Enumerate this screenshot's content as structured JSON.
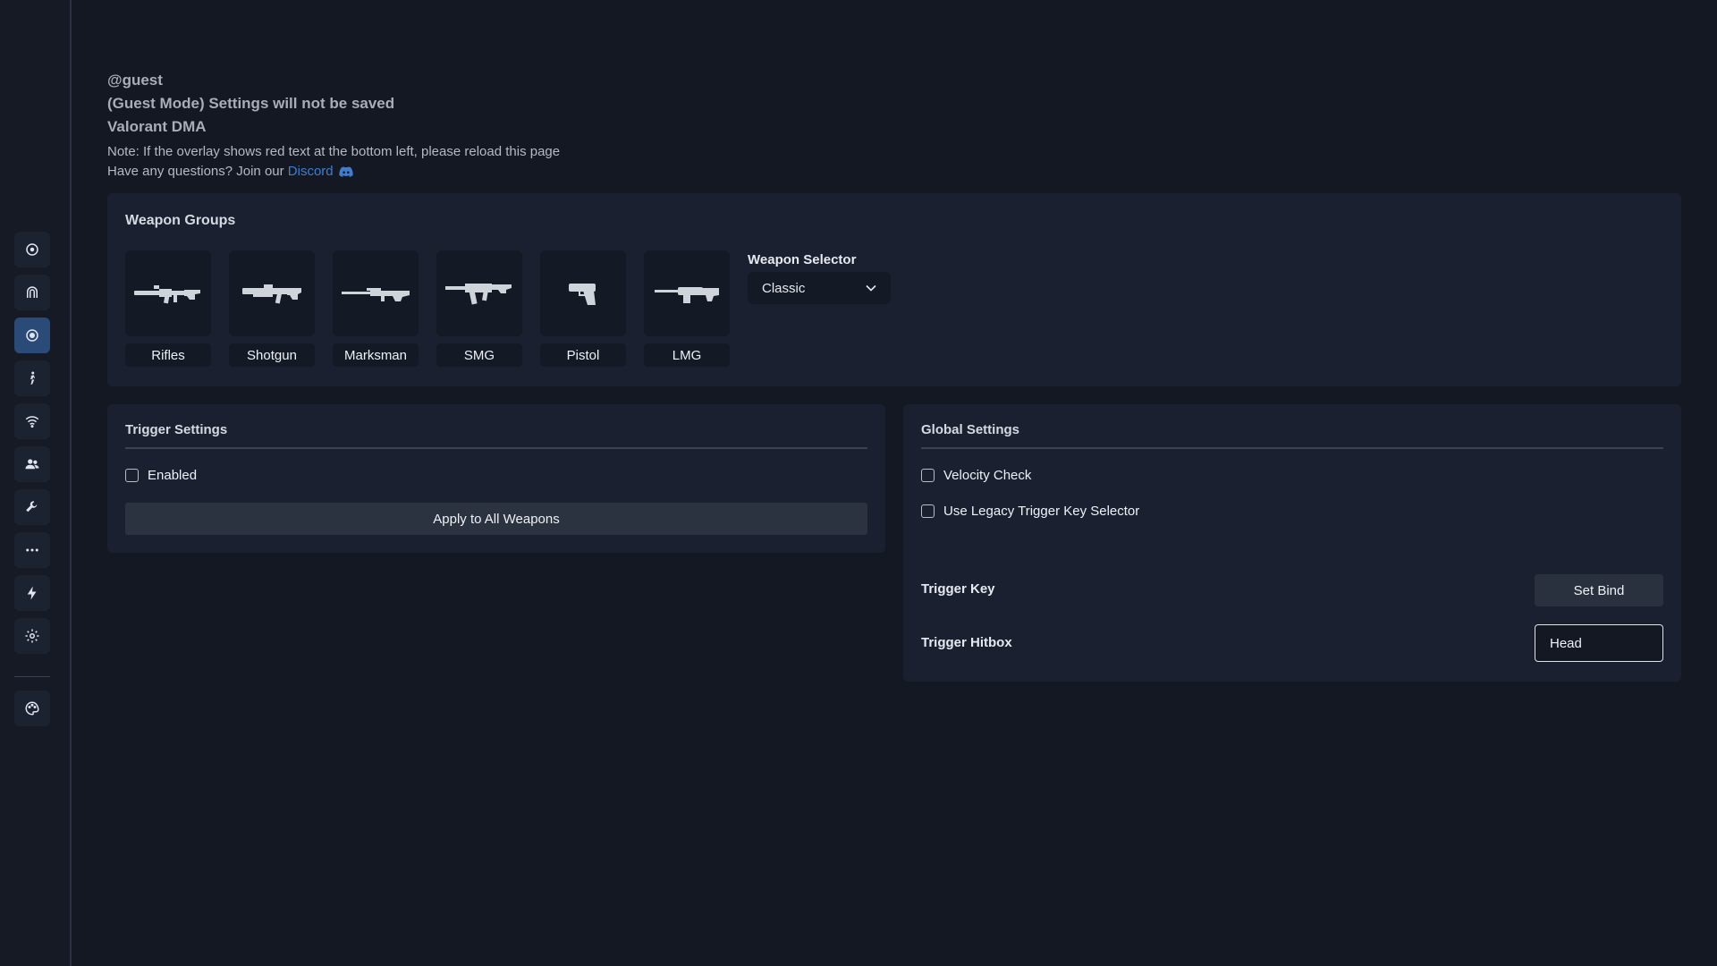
{
  "sidebar": {
    "items": [
      {
        "icon": "crosshair-icon",
        "active": false
      },
      {
        "icon": "magnet-icon",
        "active": false
      },
      {
        "icon": "target-icon",
        "active": true
      },
      {
        "icon": "running-person-icon",
        "active": false
      },
      {
        "icon": "wifi-icon",
        "active": false
      },
      {
        "icon": "users-icon",
        "active": false
      },
      {
        "icon": "wrench-icon",
        "active": false
      },
      {
        "icon": "more-icon",
        "active": false
      },
      {
        "icon": "lightning-icon",
        "active": false
      },
      {
        "icon": "gear-icon",
        "active": false
      }
    ],
    "bottom": {
      "icon": "palette-icon"
    }
  },
  "header": {
    "user": "@guest",
    "guest_notice": "(Guest Mode) Settings will not be saved",
    "product": "Valorant DMA",
    "note": "Note: If the overlay shows red text at the bottom left, please reload this page",
    "questions_prefix": "Have any questions? Join our ",
    "discord_link": "Discord"
  },
  "weapon_groups": {
    "title": "Weapon Groups",
    "items": [
      {
        "label": "Rifles",
        "icon": "rifle-icon"
      },
      {
        "label": "Shotgun",
        "icon": "shotgun-icon"
      },
      {
        "label": "Marksman",
        "icon": "sniper-icon"
      },
      {
        "label": "SMG",
        "icon": "smg-icon"
      },
      {
        "label": "Pistol",
        "icon": "pistol-icon"
      },
      {
        "label": "LMG",
        "icon": "lmg-icon"
      }
    ],
    "selector_label": "Weapon Selector",
    "selector_value": "Classic"
  },
  "trigger_settings": {
    "title": "Trigger Settings",
    "enabled_label": "Enabled",
    "enabled": false,
    "apply_label": "Apply to All Weapons"
  },
  "global_settings": {
    "title": "Global Settings",
    "velocity_label": "Velocity Check",
    "velocity_checked": false,
    "legacy_label": "Use Legacy Trigger Key Selector",
    "legacy_checked": false,
    "trigger_key_label": "Trigger Key",
    "set_bind_label": "Set Bind",
    "trigger_hitbox_label": "Trigger Hitbox",
    "hitbox_value": "Head"
  },
  "colors": {
    "background": "#131823",
    "panel": "#1a2030",
    "accent": "#2a4a77",
    "link": "#3f7ecf"
  }
}
